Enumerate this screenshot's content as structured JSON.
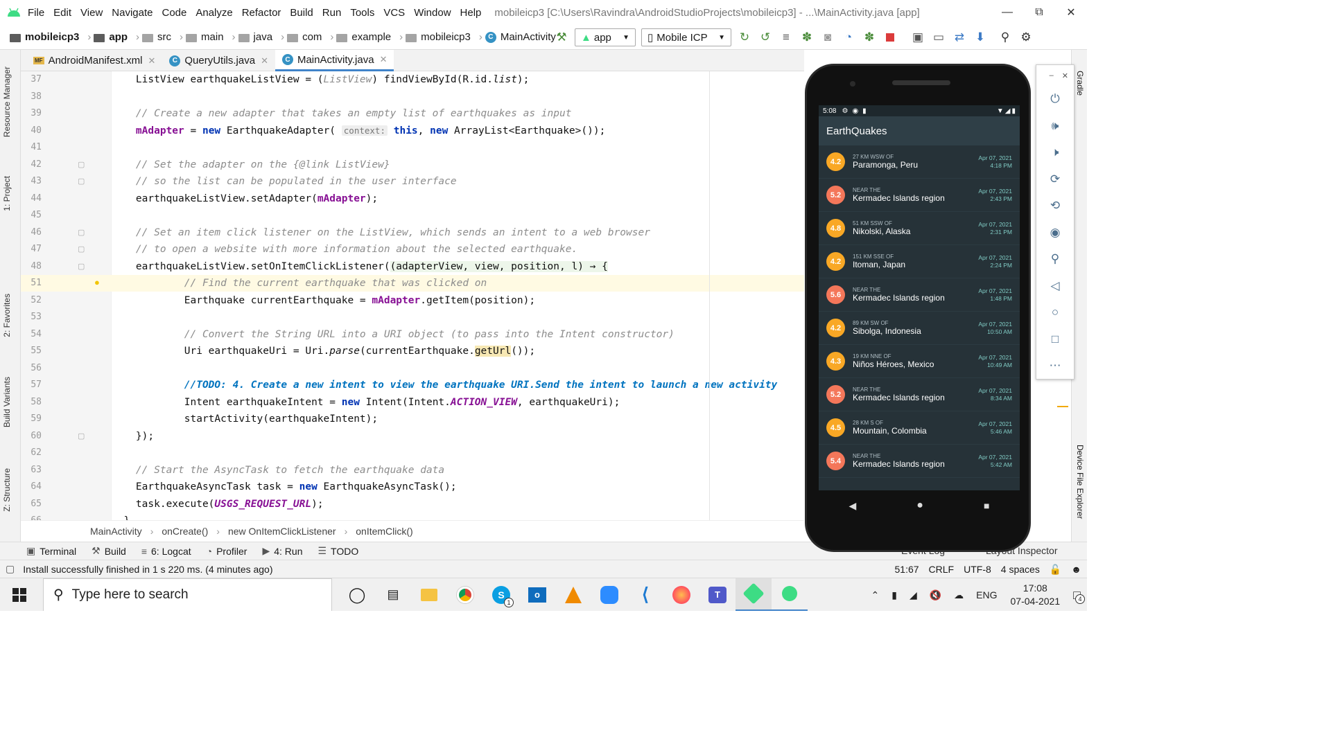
{
  "window": {
    "menu": [
      "File",
      "Edit",
      "View",
      "Navigate",
      "Code",
      "Analyze",
      "Refactor",
      "Build",
      "Run",
      "Tools",
      "VCS",
      "Window",
      "Help"
    ],
    "title": "mobileicp3 [C:\\Users\\Ravindra\\AndroidStudioProjects\\mobileicp3] - ...\\MainActivity.java [app]",
    "controls": [
      "minimize",
      "restore",
      "close"
    ]
  },
  "nav": {
    "breadcrumbs": [
      "mobileicp3",
      "app",
      "src",
      "main",
      "java",
      "com",
      "example",
      "mobileicp3",
      "MainActivity"
    ],
    "run_config": "app",
    "device": "Mobile ICP"
  },
  "tabs": [
    {
      "label": "AndroidManifest.xml",
      "icon": "MF"
    },
    {
      "label": "QueryUtils.java",
      "icon": "C"
    },
    {
      "label": "MainActivity.java",
      "icon": "C",
      "active": true
    }
  ],
  "left_tools": [
    "Resource Manager",
    "1: Project",
    "2: Favorites",
    "Build Variants",
    "Z: Structure"
  ],
  "right_tools": [
    "Gradle",
    "Device File Explorer"
  ],
  "code": {
    "lines": [
      {
        "n": "37",
        "parts": [
          [
            "p",
            "    ListView earthquakeListView = ("
          ],
          [
            "hint2",
            "ListView"
          ],
          [
            "p",
            ") findViewById(R.id."
          ],
          [
            "it",
            "list"
          ],
          [
            "p",
            ");"
          ]
        ]
      },
      {
        "n": "38",
        "parts": []
      },
      {
        "n": "39",
        "parts": [
          [
            "cm",
            "    // Create a new adapter that takes an empty list of earthquakes as input"
          ]
        ]
      },
      {
        "n": "40",
        "parts": [
          [
            "fld",
            "    mAdapter"
          ],
          [
            "p",
            " = "
          ],
          [
            "kw",
            "new"
          ],
          [
            "p",
            " EarthquakeAdapter( "
          ],
          [
            "hint",
            "context:"
          ],
          [
            "p",
            " "
          ],
          [
            "kw",
            "this"
          ],
          [
            "p",
            ", "
          ],
          [
            "kw",
            "new"
          ],
          [
            "p",
            " ArrayList<Earthquake>());"
          ]
        ]
      },
      {
        "n": "41",
        "parts": []
      },
      {
        "n": "42",
        "parts": [
          [
            "cm",
            "    // Set the adapter on the {@link ListView}"
          ]
        ]
      },
      {
        "n": "43",
        "parts": [
          [
            "cm",
            "    // so the list can be populated in the user interface"
          ]
        ]
      },
      {
        "n": "44",
        "parts": [
          [
            "p",
            "    earthquakeListView.setAdapter("
          ],
          [
            "fld",
            "mAdapter"
          ],
          [
            "p",
            ");"
          ]
        ]
      },
      {
        "n": "45",
        "parts": []
      },
      {
        "n": "46",
        "parts": [
          [
            "cm",
            "    // Set an item click listener on the ListView, which sends an intent to a web browser"
          ]
        ]
      },
      {
        "n": "47",
        "parts": [
          [
            "cm",
            "    // to open a website with more information about the selected earthquake."
          ]
        ]
      },
      {
        "n": "48",
        "parts": [
          [
            "p",
            "    earthquakeListView.setOnItemClickListener("
          ],
          [
            "lam",
            "(adapterView, view, position, l) → {"
          ]
        ]
      },
      {
        "n": "51",
        "hl": true,
        "parts": [
          [
            "cm",
            "            // Find the current earthquake that was clicked on"
          ]
        ]
      },
      {
        "n": "52",
        "parts": [
          [
            "p",
            "            Earthquake currentEarthquake = "
          ],
          [
            "fld",
            "mAdapter"
          ],
          [
            "p",
            ".getItem(position);"
          ]
        ]
      },
      {
        "n": "53",
        "parts": []
      },
      {
        "n": "54",
        "parts": [
          [
            "cm",
            "            // Convert the String URL into a URI object (to pass into the Intent constructor)"
          ]
        ]
      },
      {
        "n": "55",
        "parts": [
          [
            "p",
            "            Uri earthquakeUri = Uri."
          ],
          [
            "it",
            "parse"
          ],
          [
            "p",
            "(currentEarthquake."
          ],
          [
            "gu",
            "getUrl"
          ],
          [
            "p",
            "());"
          ]
        ]
      },
      {
        "n": "56",
        "parts": []
      },
      {
        "n": "57",
        "parts": [
          [
            "todo",
            "            //TODO: 4. Create a new intent to view the earthquake URI.Send the intent to launch a new activity"
          ]
        ]
      },
      {
        "n": "58",
        "parts": [
          [
            "p",
            "            Intent earthquakeIntent = "
          ],
          [
            "kw",
            "new"
          ],
          [
            "p",
            " Intent(Intent."
          ],
          [
            "const",
            "ACTION_VIEW"
          ],
          [
            "p",
            ", earthquakeUri);"
          ]
        ]
      },
      {
        "n": "59",
        "parts": [
          [
            "p",
            "            startActivity(earthquakeIntent);"
          ]
        ]
      },
      {
        "n": "60",
        "parts": [
          [
            "p",
            "    });"
          ]
        ]
      },
      {
        "n": "62",
        "parts": []
      },
      {
        "n": "63",
        "parts": [
          [
            "cm",
            "    // Start the AsyncTask to fetch the earthquake data"
          ]
        ]
      },
      {
        "n": "64",
        "parts": [
          [
            "p",
            "    EarthquakeAsyncTask task = "
          ],
          [
            "kw",
            "new"
          ],
          [
            "p",
            " EarthquakeAsyncTask();"
          ]
        ]
      },
      {
        "n": "65",
        "parts": [
          [
            "p",
            "    task.execute("
          ],
          [
            "const",
            "USGS_REQUEST_URL"
          ],
          [
            "p",
            ");"
          ]
        ]
      },
      {
        "n": "66",
        "parts": [
          [
            "p",
            "  }"
          ]
        ]
      }
    ]
  },
  "code_breadcrumbs": [
    "MainActivity",
    "onCreate()",
    "new OnItemClickListener",
    "onItemClick()"
  ],
  "tool_tabs": [
    "Terminal",
    "Build",
    "6: Logcat",
    "Profiler",
    "4: Run",
    "TODO"
  ],
  "tool_tabs_right": [
    "Event Log",
    "Layout Inspector"
  ],
  "status": {
    "message": "Install successfully finished in 1 s 220 ms. (4 minutes ago)",
    "position": "51:67",
    "line_sep": "CRLF",
    "encoding": "UTF-8",
    "indent": "4 spaces"
  },
  "emulator": {
    "time": "5:08",
    "app_title": "EarthQuakes",
    "quakes": [
      {
        "mag": "4.2",
        "offset": "27 KM WSW OF",
        "place": "Paramonga, Peru",
        "date": "Apr 07, 2021",
        "time": "4:18 PM",
        "color": "#f9a825"
      },
      {
        "mag": "5.2",
        "offset": "NEAR THE",
        "place": "Kermadec Islands region",
        "date": "Apr 07, 2021",
        "time": "2:43 PM",
        "color": "#f4775a"
      },
      {
        "mag": "4.8",
        "offset": "51 KM SSW OF",
        "place": "Nikolski, Alaska",
        "date": "Apr 07, 2021",
        "time": "2:31 PM",
        "color": "#f9a825"
      },
      {
        "mag": "4.2",
        "offset": "151 KM SSE OF",
        "place": "Itoman, Japan",
        "date": "Apr 07, 2021",
        "time": "2:24 PM",
        "color": "#f9a825"
      },
      {
        "mag": "5.6",
        "offset": "NEAR THE",
        "place": "Kermadec Islands region",
        "date": "Apr 07, 2021",
        "time": "1:48 PM",
        "color": "#f4775a"
      },
      {
        "mag": "4.2",
        "offset": "89 KM SW OF",
        "place": "Sibolga, Indonesia",
        "date": "Apr 07, 2021",
        "time": "10:50 AM",
        "color": "#f9a825"
      },
      {
        "mag": "4.3",
        "offset": "19 KM NNE OF",
        "place": "Niños Héroes, Mexico",
        "date": "Apr 07, 2021",
        "time": "10:49 AM",
        "color": "#f9a825"
      },
      {
        "mag": "5.2",
        "offset": "NEAR THE",
        "place": "Kermadec Islands region",
        "date": "Apr 07, 2021",
        "time": "8:34 AM",
        "color": "#f4775a"
      },
      {
        "mag": "4.5",
        "offset": "28 KM S OF",
        "place": "Mountain, Colombia",
        "date": "Apr 07, 2021",
        "time": "5:46 AM",
        "color": "#f9a825"
      },
      {
        "mag": "5.4",
        "offset": "NEAR THE",
        "place": "Kermadec Islands region",
        "date": "Apr 07, 2021",
        "time": "5:42 AM",
        "color": "#f4775a"
      }
    ],
    "panel_buttons": [
      "power-icon",
      "volume-up-icon",
      "volume-down-icon",
      "rotate-left-icon",
      "rotate-right-icon",
      "camera-icon",
      "zoom-icon",
      "back-icon",
      "home-icon",
      "overview-icon",
      "more-icon"
    ]
  },
  "taskbar": {
    "search_placeholder": "Type here to search",
    "language": "ENG",
    "time": "17:08",
    "date": "07-04-2021",
    "notification_count": "4",
    "skype_badge": "1"
  }
}
